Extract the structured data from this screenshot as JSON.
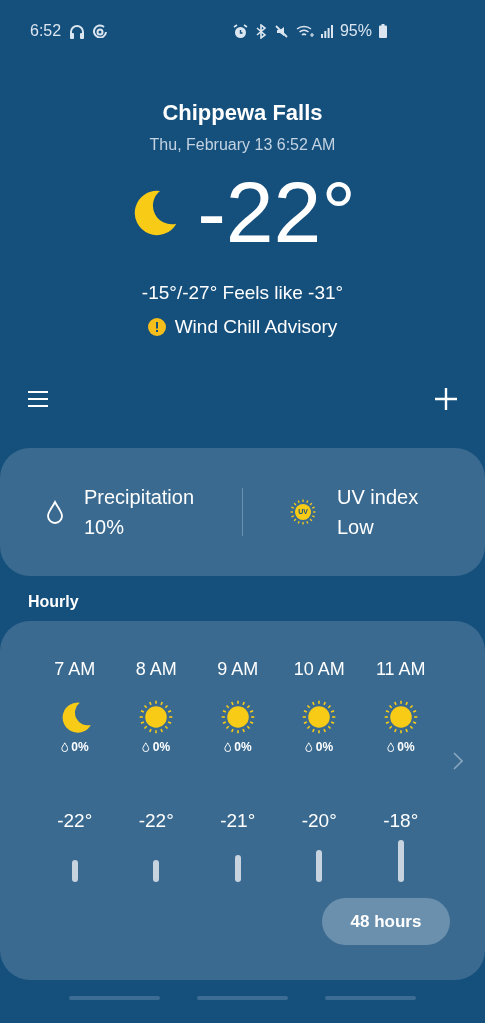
{
  "status_bar": {
    "time": "6:52",
    "battery": "95%"
  },
  "location": {
    "city": "Chippewa Falls",
    "date": "Thu, February 13 6:52 AM",
    "kind": "moon",
    "temperature": "-22°",
    "high_low_feels": "-15°/-27° Feels like -31°",
    "alert": "Wind Chill Advisory"
  },
  "summary": [
    {
      "kind": "precipitation",
      "label": "Precipitation",
      "value": "10%"
    },
    {
      "kind": "uv",
      "label": "UV index",
      "value": "Low",
      "badge": "UV"
    }
  ],
  "hourly": {
    "title": "Hourly",
    "hours": [
      {
        "time": "7 AM",
        "kind": "moon",
        "precipitation": "0%",
        "temperature": "-22°"
      },
      {
        "time": "8 AM",
        "kind": "sun",
        "precipitation": "0%",
        "temperature": "-22°"
      },
      {
        "time": "9 AM",
        "kind": "sun",
        "precipitation": "0%",
        "temperature": "-21°"
      },
      {
        "time": "10 AM",
        "kind": "sun",
        "precipitation": "0%",
        "temperature": "-20°"
      },
      {
        "time": "11 AM",
        "kind": "sun",
        "precipitation": "0%",
        "temperature": "-18°"
      }
    ],
    "button": "48 hours"
  }
}
